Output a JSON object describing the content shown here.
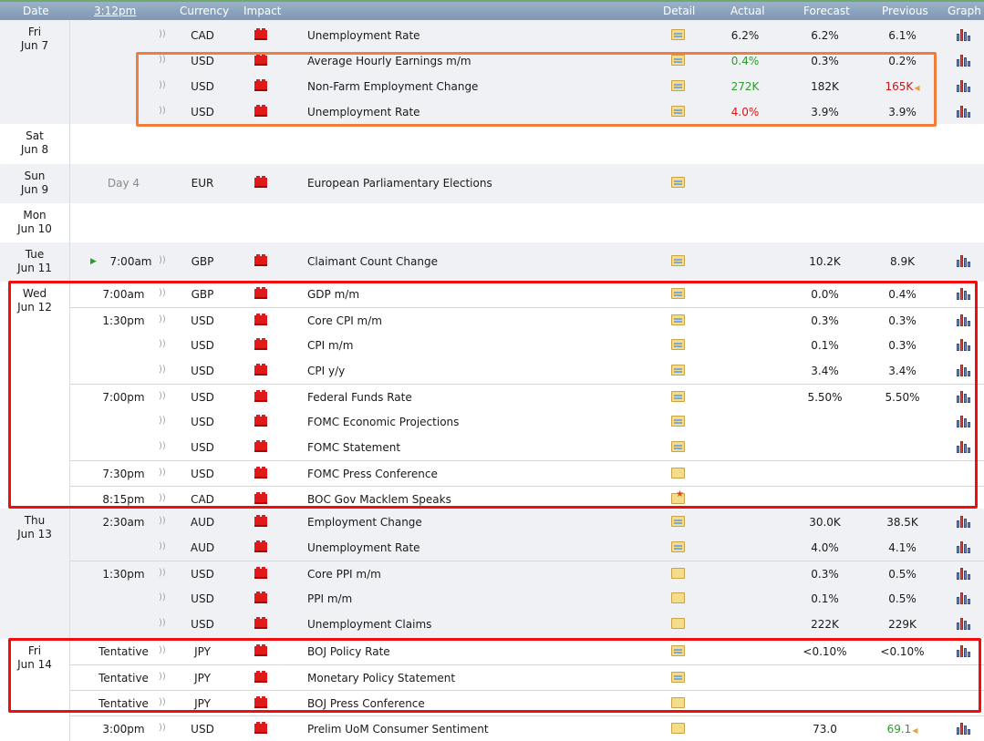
{
  "header": {
    "date": "Date",
    "time": "3:12pm",
    "currency": "Currency",
    "impact": "Impact",
    "detail": "Detail",
    "actual": "Actual",
    "forecast": "Forecast",
    "previous": "Previous",
    "graph": "Graph"
  },
  "days": [
    {
      "day": "Fri",
      "date": "Jun 7",
      "rows": [
        {
          "time": "",
          "currency": "CAD",
          "event": "Unemployment Rate",
          "actual": "6.2%",
          "actual_status": "",
          "forecast": "6.2%",
          "previous": "6.1%",
          "detail_icon": "folder-icon",
          "graph": true
        },
        {
          "time": "",
          "currency": "USD",
          "event": "Average Hourly Earnings m/m",
          "actual": "0.4%",
          "actual_status": "better",
          "forecast": "0.3%",
          "previous": "0.2%",
          "detail_icon": "folder-icon",
          "graph": true
        },
        {
          "time": "",
          "currency": "USD",
          "event": "Non-Farm Employment Change",
          "actual": "272K",
          "actual_status": "better",
          "forecast": "182K",
          "previous": "165K",
          "previous_revised": true,
          "detail_icon": "folder-icon",
          "graph": true
        },
        {
          "time": "",
          "currency": "USD",
          "event": "Unemployment Rate",
          "actual": "4.0%",
          "actual_status": "worse",
          "forecast": "3.9%",
          "previous": "3.9%",
          "detail_icon": "folder-icon",
          "graph": true
        }
      ]
    },
    {
      "day": "Sat",
      "date": "Jun 8",
      "rows": []
    },
    {
      "day": "Sun",
      "date": "Jun 9",
      "rows": [
        {
          "time": "Day 4",
          "time_muted": true,
          "currency": "EUR",
          "event": "European Parliamentary Elections",
          "actual": "",
          "forecast": "",
          "previous": "",
          "detail_icon": "folder-icon",
          "graph": false,
          "no_speaker": true
        }
      ]
    },
    {
      "day": "Mon",
      "date": "Jun 10",
      "rows": []
    },
    {
      "day": "Tue",
      "date": "Jun 11",
      "rows": [
        {
          "time": "7:00am",
          "next_up": true,
          "currency": "GBP",
          "event": "Claimant Count Change",
          "actual": "",
          "forecast": "10.2K",
          "previous": "8.9K",
          "detail_icon": "folder-icon",
          "graph": true
        }
      ]
    },
    {
      "day": "Wed",
      "date": "Jun 12",
      "rows": [
        {
          "time": "7:00am",
          "currency": "GBP",
          "event": "GDP m/m",
          "actual": "",
          "forecast": "0.0%",
          "previous": "0.4%",
          "detail_icon": "folder-icon",
          "graph": true
        },
        {
          "time": "1:30pm",
          "currency": "USD",
          "event": "Core CPI m/m",
          "actual": "",
          "forecast": "0.3%",
          "previous": "0.3%",
          "detail_icon": "folder-icon",
          "graph": true,
          "sep": true
        },
        {
          "time": "",
          "currency": "USD",
          "event": "CPI m/m",
          "actual": "",
          "forecast": "0.1%",
          "previous": "0.3%",
          "detail_icon": "folder-icon",
          "graph": true
        },
        {
          "time": "",
          "currency": "USD",
          "event": "CPI y/y",
          "actual": "",
          "forecast": "3.4%",
          "previous": "3.4%",
          "detail_icon": "folder-icon",
          "graph": true
        },
        {
          "time": "7:00pm",
          "currency": "USD",
          "event": "Federal Funds Rate",
          "actual": "",
          "forecast": "5.50%",
          "previous": "5.50%",
          "detail_icon": "folder-icon",
          "graph": true,
          "sep": true
        },
        {
          "time": "",
          "currency": "USD",
          "event": "FOMC Economic Projections",
          "actual": "",
          "forecast": "",
          "previous": "",
          "detail_icon": "folder-icon",
          "graph": true
        },
        {
          "time": "",
          "currency": "USD",
          "event": "FOMC Statement",
          "actual": "",
          "forecast": "",
          "previous": "",
          "detail_icon": "folder-icon",
          "graph": true
        },
        {
          "time": "7:30pm",
          "currency": "USD",
          "event": "FOMC Press Conference",
          "actual": "",
          "forecast": "",
          "previous": "",
          "detail_icon": "folder-plain-icon",
          "graph": false,
          "sep": true
        },
        {
          "time": "8:15pm",
          "currency": "CAD",
          "event": "BOC Gov Macklem Speaks",
          "actual": "",
          "forecast": "",
          "previous": "",
          "detail_icon": "folder-star-icon",
          "graph": false,
          "sep": true
        }
      ]
    },
    {
      "day": "Thu",
      "date": "Jun 13",
      "rows": [
        {
          "time": "2:30am",
          "currency": "AUD",
          "event": "Employment Change",
          "actual": "",
          "forecast": "30.0K",
          "previous": "38.5K",
          "detail_icon": "folder-icon",
          "graph": true
        },
        {
          "time": "",
          "currency": "AUD",
          "event": "Unemployment Rate",
          "actual": "",
          "forecast": "4.0%",
          "previous": "4.1%",
          "detail_icon": "folder-icon",
          "graph": true
        },
        {
          "time": "1:30pm",
          "currency": "USD",
          "event": "Core PPI m/m",
          "actual": "",
          "forecast": "0.3%",
          "previous": "0.5%",
          "detail_icon": "folder-plain-icon",
          "graph": true,
          "sep": true
        },
        {
          "time": "",
          "currency": "USD",
          "event": "PPI m/m",
          "actual": "",
          "forecast": "0.1%",
          "previous": "0.5%",
          "detail_icon": "folder-plain-icon",
          "graph": true
        },
        {
          "time": "",
          "currency": "USD",
          "event": "Unemployment Claims",
          "actual": "",
          "forecast": "222K",
          "previous": "229K",
          "detail_icon": "folder-plain-icon",
          "graph": true
        }
      ]
    },
    {
      "day": "Fri",
      "date": "Jun 14",
      "rows": [
        {
          "time": "Tentative",
          "currency": "JPY",
          "event": "BOJ Policy Rate",
          "actual": "",
          "forecast": "<0.10%",
          "previous": "<0.10%",
          "detail_icon": "folder-icon",
          "graph": true
        },
        {
          "time": "Tentative",
          "currency": "JPY",
          "event": "Monetary Policy Statement",
          "actual": "",
          "forecast": "",
          "previous": "",
          "detail_icon": "folder-icon",
          "graph": false,
          "sep": true
        },
        {
          "time": "Tentative",
          "currency": "JPY",
          "event": "BOJ Press Conference",
          "actual": "",
          "forecast": "",
          "previous": "",
          "detail_icon": "folder-plain-icon",
          "graph": false,
          "sep": true
        },
        {
          "time": "3:00pm",
          "currency": "USD",
          "event": "Prelim UoM Consumer Sentiment",
          "actual": "",
          "forecast": "73.0",
          "previous": "69.1",
          "previous_status": "better",
          "previous_revised": true,
          "detail_icon": "folder-plain-icon",
          "graph": true,
          "sep": true
        }
      ]
    }
  ],
  "colors": {
    "header": "#8aa2bd",
    "row_gray": "#f0f1f4",
    "better": "#2e9a2e",
    "worse": "#d01616",
    "highlight_orange": "#f07d3c",
    "highlight_red": "#f00d0d"
  },
  "icons": {
    "speaker": "speaker-icon",
    "impact": "high-impact-folder-icon",
    "graph": "bar-chart-icon",
    "next": "play-arrow-icon"
  }
}
